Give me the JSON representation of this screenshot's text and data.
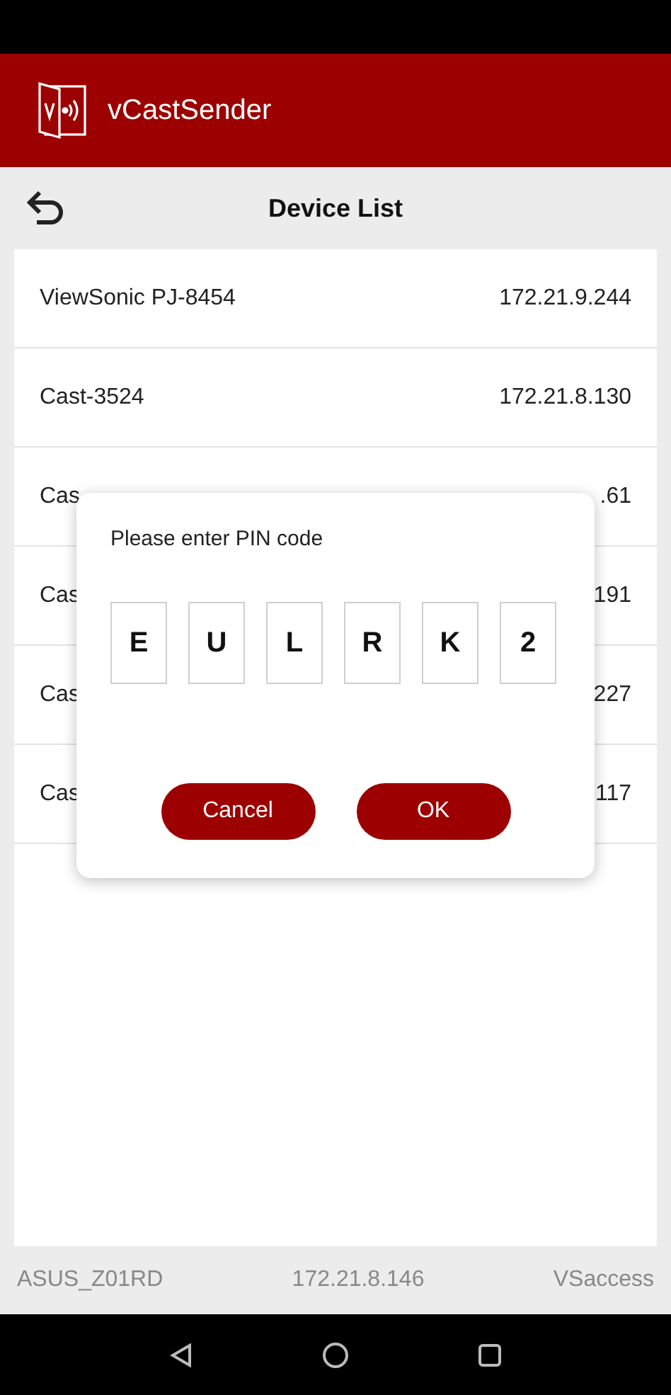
{
  "app_bar": {
    "title": "vCastSender"
  },
  "toolbar": {
    "title": "Device List"
  },
  "devices": [
    {
      "name": "ViewSonic PJ-8454",
      "ip": "172.21.9.244"
    },
    {
      "name": "Cast-3524",
      "ip": "172.21.8.130"
    },
    {
      "name": "Cas",
      "ip": ".61"
    },
    {
      "name": "Cas",
      "ip": "191"
    },
    {
      "name": "Cas",
      "ip": "227"
    },
    {
      "name": "Cas",
      "ip": "117"
    }
  ],
  "dialog": {
    "prompt": "Please enter PIN code",
    "pin": [
      "E",
      "U",
      "L",
      "R",
      "K",
      "2"
    ],
    "buttons": [
      "Cancel",
      "OK"
    ]
  },
  "footer": {
    "device": "ASUS_Z01RD",
    "ip": "172.21.8.146",
    "network": "VSaccess"
  }
}
